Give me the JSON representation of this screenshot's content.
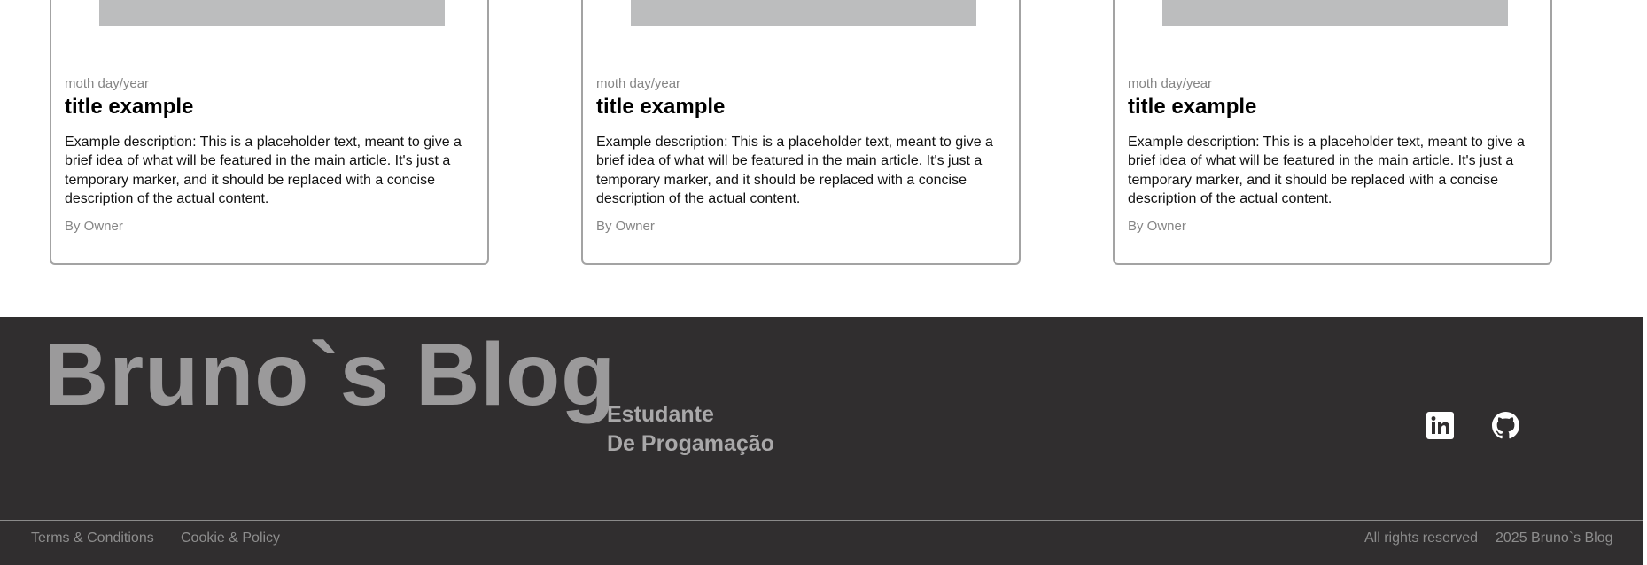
{
  "cards": [
    {
      "date": "moth day/year",
      "title": "title example",
      "description": "Example description: This is a placeholder text, meant to give a brief idea of what will be featured in the main article. It's just a temporary marker, and it should be replaced with a concise description of the actual content.",
      "author": "By Owner"
    },
    {
      "date": "moth day/year",
      "title": "title example",
      "description": "Example description: This is a placeholder text, meant to give a brief idea of what will be featured in the main article. It's just a temporary marker, and it should be replaced with a concise description of the actual content.",
      "author": "By Owner"
    },
    {
      "date": "moth day/year",
      "title": "title example",
      "description": "Example description: This is a placeholder text, meant to give a brief idea of what will be featured in the main article. It's just a temporary marker, and it should be replaced with a concise description of the actual content.",
      "author": "By Owner"
    }
  ],
  "footer": {
    "brand": "Bruno`s Blog",
    "subtitle_line1": "Estudante",
    "subtitle_line2": "De Progamação",
    "social": [
      "linkedin-icon",
      "github-icon"
    ],
    "links": [
      "Terms & Conditions",
      "Cookie & Policy"
    ],
    "rights": "All rights reserved",
    "copyright": "2025 Bruno`s Blog",
    "background": "#302e2f"
  }
}
